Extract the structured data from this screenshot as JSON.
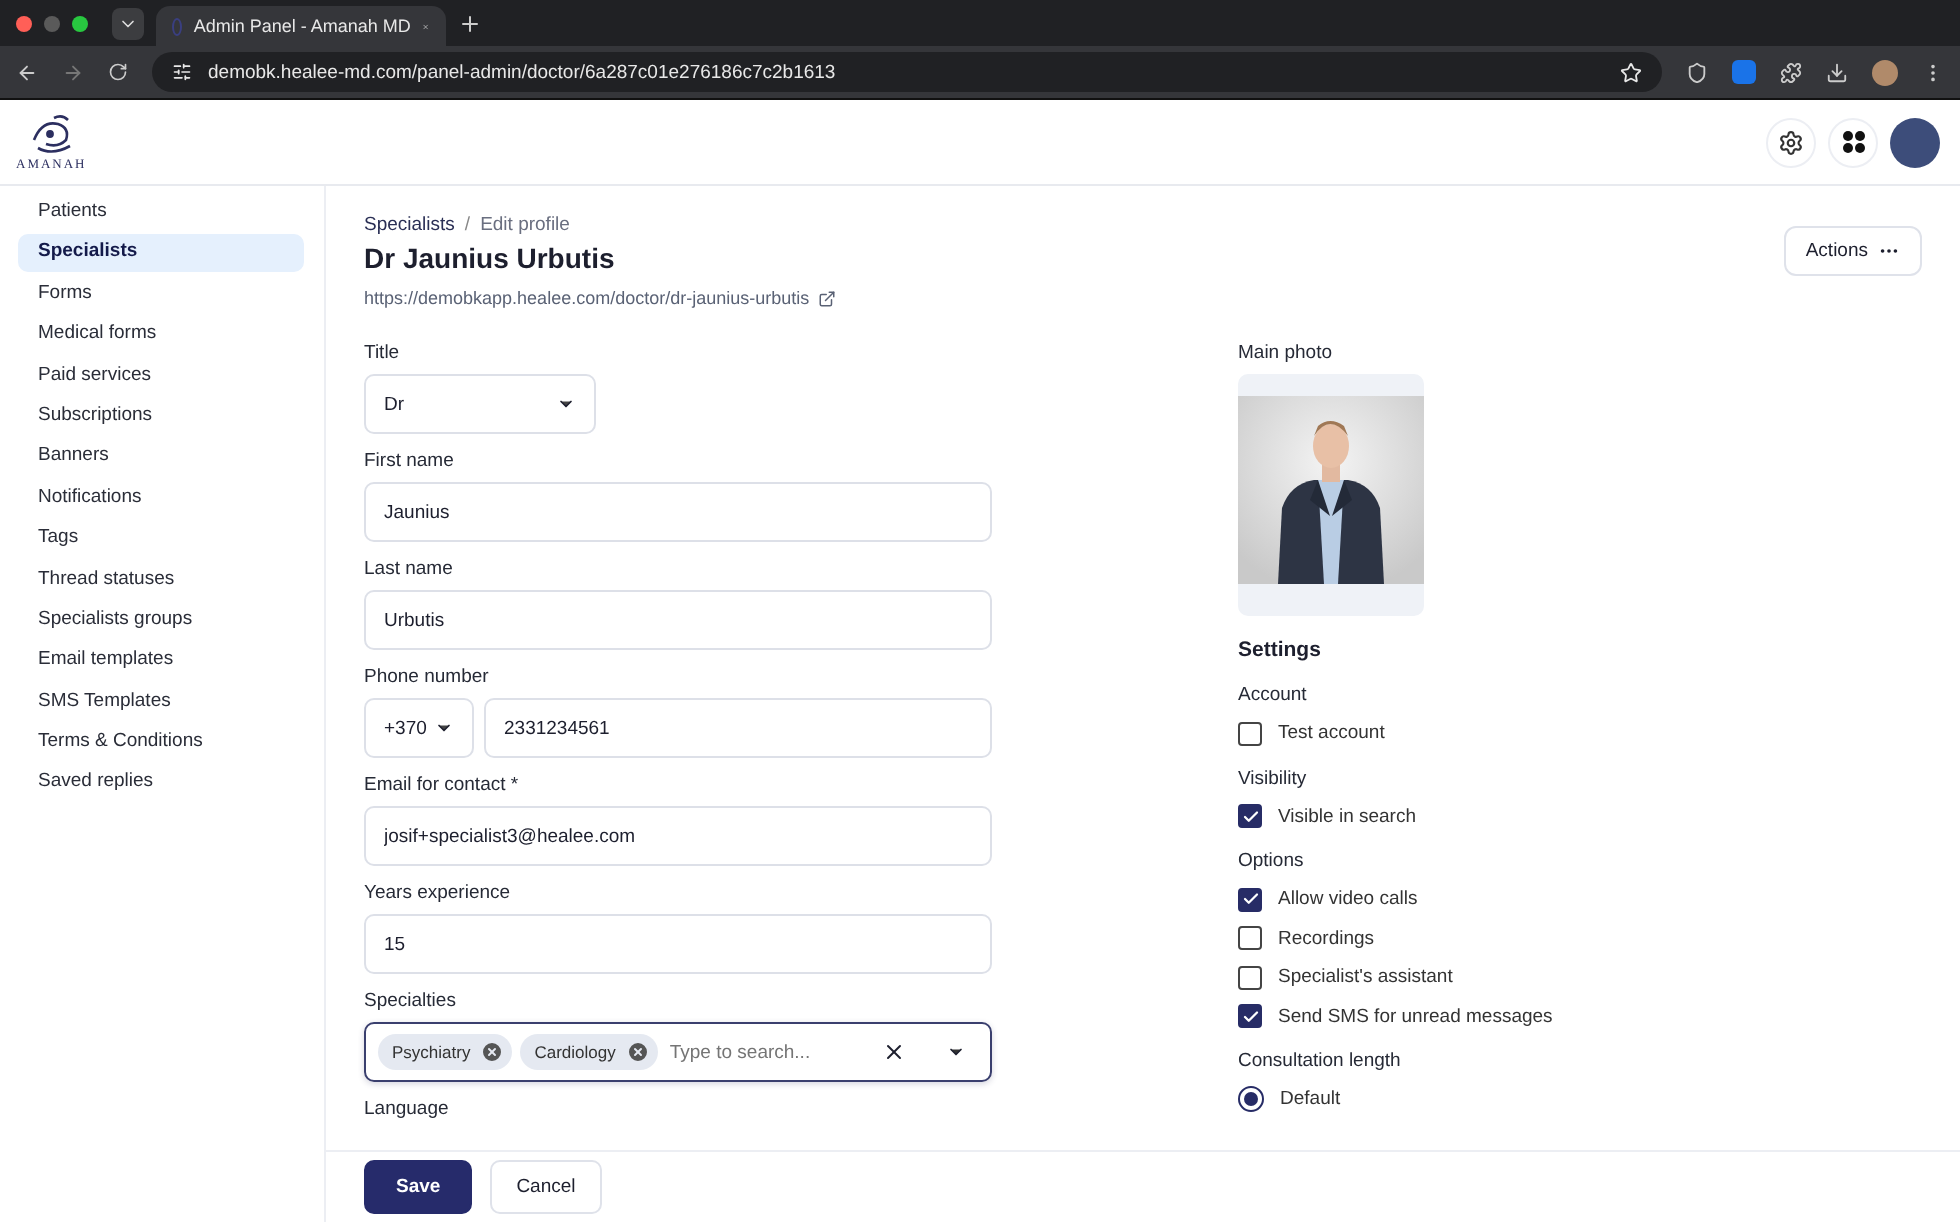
{
  "browser": {
    "tab_title": "Admin Panel - Amanah MD",
    "url": "demobk.healee-md.com/panel-admin/doctor/6a287c01e276186c7c2b1613"
  },
  "app": {
    "logo_text": "AMANAH"
  },
  "sidebar": {
    "items": [
      {
        "label": "Patients",
        "selected": false
      },
      {
        "label": "Specialists",
        "selected": true
      },
      {
        "label": "Forms",
        "selected": false
      },
      {
        "label": "Medical forms",
        "selected": false
      },
      {
        "label": "Paid services",
        "selected": false
      },
      {
        "label": "Subscriptions",
        "selected": false
      },
      {
        "label": "Banners",
        "selected": false
      },
      {
        "label": "Notifications",
        "selected": false
      },
      {
        "label": "Tags",
        "selected": false
      },
      {
        "label": "Thread statuses",
        "selected": false
      },
      {
        "label": "Specialists groups",
        "selected": false
      },
      {
        "label": "Email templates",
        "selected": false
      },
      {
        "label": "SMS Templates",
        "selected": false
      },
      {
        "label": "Terms & Conditions",
        "selected": false
      },
      {
        "label": "Saved replies",
        "selected": false
      }
    ]
  },
  "header": {
    "breadcrumb": [
      "Specialists",
      "Edit profile"
    ],
    "breadcrumb_separator": "/",
    "title": "Dr Jaunius Urbutis",
    "profile_url": "https://demobkapp.healee.com/doctor/dr-jaunius-urbutis",
    "actions_button": "Actions"
  },
  "form": {
    "fields": [
      {
        "kind": "select",
        "label": "Title",
        "value": "Dr"
      },
      {
        "kind": "text",
        "label": "First name",
        "value": "Jaunius"
      },
      {
        "kind": "text",
        "label": "Last name",
        "value": "Urbutis"
      },
      {
        "kind": "phone",
        "label": "Phone number",
        "code": "+370",
        "value": "2331234561"
      },
      {
        "kind": "text",
        "label": "Email for contact *",
        "value": "josif+specialist3@healee.com"
      },
      {
        "kind": "text",
        "label": "Years experience",
        "value": "15"
      },
      {
        "kind": "tags",
        "label": "Specialties",
        "tags": [
          "Psychiatry",
          "Cardiology"
        ],
        "placeholder": "Type to search..."
      },
      {
        "kind": "heading",
        "label": "Language"
      }
    ]
  },
  "side": {
    "photo_label": "Main photo",
    "settings_title": "Settings",
    "groups": [
      {
        "title": "Account",
        "options": [
          {
            "label": "Test account",
            "checked": false
          }
        ]
      },
      {
        "title": "Visibility",
        "options": [
          {
            "label": "Visible in search",
            "checked": true
          }
        ]
      },
      {
        "title": "Options",
        "options": [
          {
            "label": "Allow video calls",
            "checked": true
          },
          {
            "label": "Recordings",
            "checked": false
          },
          {
            "label": "Specialist's assistant",
            "checked": false
          },
          {
            "label": "Send SMS for unread messages",
            "checked": true
          }
        ]
      }
    ],
    "consultation": {
      "title": "Consultation length",
      "options": [
        {
          "label": "Default",
          "selected": true
        }
      ]
    }
  },
  "footer": {
    "buttons": [
      {
        "label": "Save",
        "kind": "primary"
      },
      {
        "label": "Cancel",
        "kind": "secondary"
      }
    ]
  }
}
